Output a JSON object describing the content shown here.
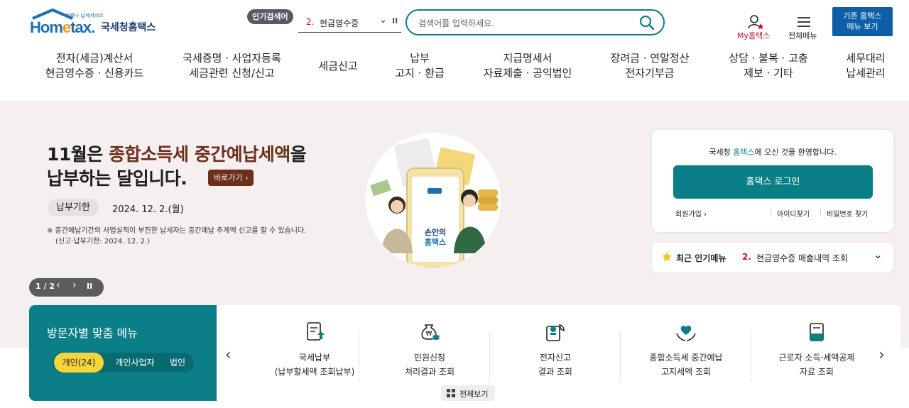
{
  "header": {
    "logo": {
      "main": "Hometax",
      "sub": "국세청홈택스",
      "tagline": "언제나 납세서비스"
    },
    "popular": {
      "badge": "인기검색어",
      "rank": "2.",
      "term": "현금영수증"
    },
    "search": {
      "placeholder": "검색어를 입력하세요."
    },
    "my_hometax": "My홈택스",
    "all_menu": "전체메뉴",
    "old_hometax": {
      "line1": "기존 홈택스",
      "line2": "메뉴 보기"
    }
  },
  "gnb": [
    {
      "line1": "전자(세금)계산서",
      "line2": "현금영수증 · 신용카드"
    },
    {
      "line1": "국세증명 · 사업자등록",
      "line2": "세금관련 신청/신고"
    },
    {
      "line1": "세금신고",
      "line2": ""
    },
    {
      "line1": "납부",
      "line2": "고지 · 환급"
    },
    {
      "line1": "지급명세서",
      "line2": "자료제출 · 공익법인"
    },
    {
      "line1": "장려금 · 연말정산",
      "line2": "전자기부금"
    },
    {
      "line1": "상담 · 불복 · 고충",
      "line2": "제보 · 기타"
    },
    {
      "line1": "세무대리",
      "line2": "납세관리"
    }
  ],
  "hero": {
    "title_a": "11월은 ",
    "title_accent": "종합소득세 중간예납세액",
    "title_b": "을",
    "title_line2": "납부하는 달입니다.",
    "goto": "바로가기 ›",
    "deadline_label": "납부기한",
    "deadline_date": "2024. 12. 2.(월)",
    "note_line1": "※ 중간예납기간의 사업실적이 부진한 납세자는 중간예납 추계액 신고를 할 수 있습니다.",
    "note_line2": "(신고·납부기한: 2024. 12. 2.)",
    "illus_text1": "손안의",
    "illus_text2": "홈택스",
    "pager": {
      "current": "1 / 2",
      "prev": "‹",
      "next": "›",
      "pause": "II"
    }
  },
  "login": {
    "welcome_a": "국세청 ",
    "welcome_hl": "홈택스",
    "welcome_b": "에 오신 것을 환영합니다.",
    "button": "홈택스 로그인",
    "signup": "회원가입 ›",
    "find_id": "아이디찾기",
    "find_pw": "비밀번호 찾기"
  },
  "recent": {
    "label": "최근 인기메뉴",
    "rank": "2.",
    "item": "현금영수증 매출내역 조회"
  },
  "visitor": {
    "title": "방문자별 맞춤 메뉴",
    "tabs": [
      "개인(24)",
      "개인사업자",
      "법인"
    ]
  },
  "quick": [
    {
      "icon": "tax-payment-document-icon",
      "line1": "국세납부",
      "line2": "(납부할세액 조회납부)"
    },
    {
      "icon": "money-bag-coins-icon",
      "line1": "민원신청",
      "line2": "처리결과 조회"
    },
    {
      "icon": "stamp-document-icon",
      "line1": "전자신고",
      "line2": "결과 조회"
    },
    {
      "icon": "hands-heart-icon",
      "line1": "종합소득세 중간예납",
      "line2": "고지세액 조회"
    },
    {
      "icon": "certificate-document-icon",
      "line1": "근로자 소득·세액공제",
      "line2": "자료 조회"
    }
  ],
  "view_all": "전체보기",
  "colors": {
    "teal": "#0a7f87",
    "navy_blue": "#0e5fa8",
    "brown_accent": "#6b2f1a",
    "red": "#c8102e",
    "yellow_tab": "#f6d53a",
    "hero_bg": "#f6efef"
  }
}
